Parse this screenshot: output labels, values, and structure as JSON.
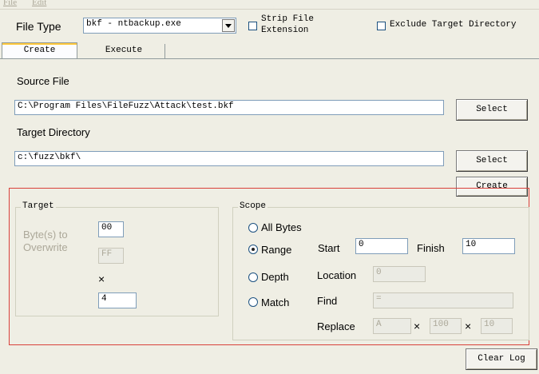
{
  "menu": {
    "file": "File",
    "edit": "Edit"
  },
  "file_type": {
    "label": "File Type",
    "selected": "bkf - ntbackup.exe"
  },
  "options": {
    "strip_file_extension": {
      "line1": "Strip File",
      "line2": "Extension",
      "checked": false
    },
    "exclude_target_directory": {
      "label": "Exclude Target Directory",
      "checked": false
    }
  },
  "tabs": [
    {
      "label": "Create",
      "active": true
    },
    {
      "label": "Execute",
      "active": false
    }
  ],
  "source_file": {
    "label": "Source File",
    "value": "C:\\Program Files\\FileFuzz\\Attack\\test.bkf",
    "button": "Select"
  },
  "target_directory": {
    "label": "Target Directory",
    "value": "c:\\fuzz\\bkf\\",
    "button": "Select"
  },
  "create_button": "Create",
  "target_group": {
    "title": "Target",
    "overwrite_label_1": "Byte(s) to",
    "overwrite_label_2": "Overwrite",
    "byte_value": "00",
    "byte_value_disabled": "FF",
    "times_symbol": "×",
    "count_value": "4"
  },
  "scope_group": {
    "title": "Scope",
    "all_bytes": "All Bytes",
    "range": "Range",
    "depth": "Depth",
    "match": "Match",
    "selected": "Range",
    "start_label": "Start",
    "start_value": "0",
    "finish_label": "Finish",
    "finish_value": "10",
    "location_label": "Location",
    "location_value": "0",
    "find_label": "Find",
    "find_value": "=",
    "replace_label": "Replace",
    "replace_value": "A",
    "replace_times_1": "×",
    "replace_count": "100",
    "replace_times_2": "×",
    "replace_count_2": "10"
  },
  "clear_log_button": "Clear Log",
  "colors": {
    "highlight_box": "#d9403a",
    "window_bg": "#efeee4"
  }
}
